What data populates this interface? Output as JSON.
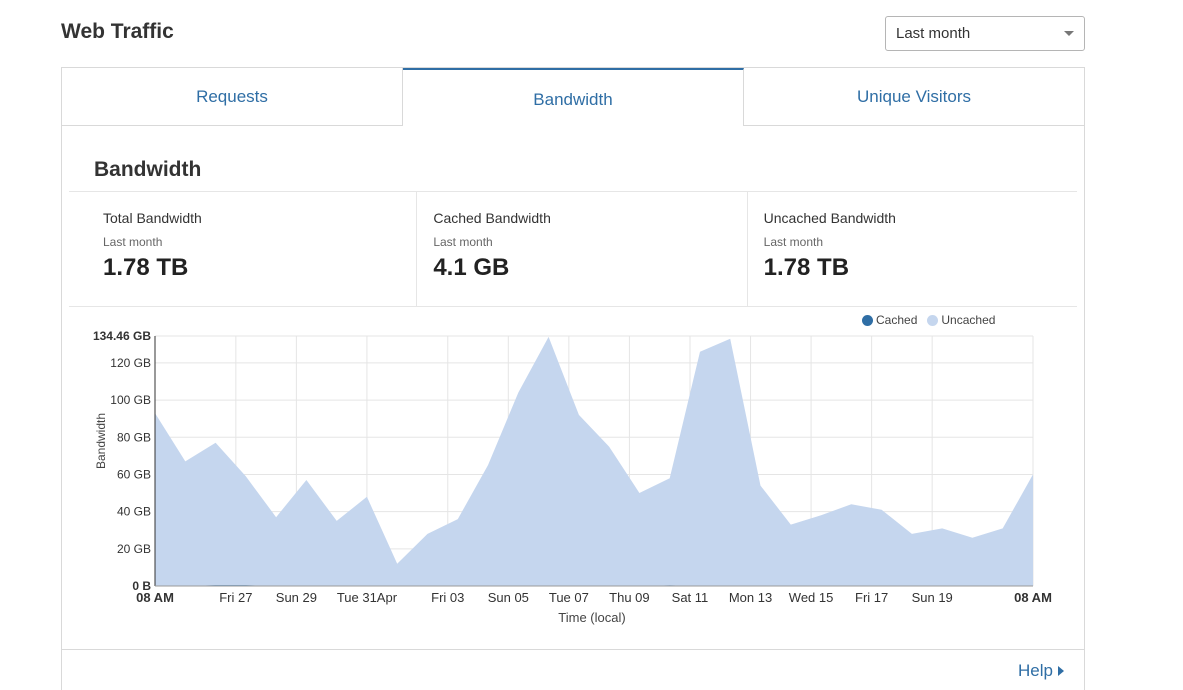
{
  "page": {
    "title": "Web Traffic"
  },
  "range_select": {
    "value": "Last month"
  },
  "tabs": [
    {
      "label": "Requests",
      "active": false
    },
    {
      "label": "Bandwidth",
      "active": true
    },
    {
      "label": "Unique Visitors",
      "active": false
    }
  ],
  "section": {
    "title": "Bandwidth"
  },
  "stats": [
    {
      "label": "Total Bandwidth",
      "period": "Last month",
      "value": "1.78 TB"
    },
    {
      "label": "Cached Bandwidth",
      "period": "Last month",
      "value": "4.1 GB"
    },
    {
      "label": "Uncached Bandwidth",
      "period": "Last month",
      "value": "1.78 TB"
    }
  ],
  "help": {
    "label": "Help"
  },
  "colors": {
    "accent": "#2f6ea5",
    "cached": "#2f6ea5",
    "uncached": "#c5d6ee",
    "grid": "#e5e5e5"
  },
  "chart_data": {
    "type": "area",
    "xlabel": "Time (local)",
    "ylabel": "Bandwidth",
    "y_unit": "GB",
    "ylim": [
      0,
      134.46
    ],
    "y_ticks": [
      {
        "value": 0,
        "label": "0 B",
        "bold": true
      },
      {
        "value": 20,
        "label": "20 GB"
      },
      {
        "value": 40,
        "label": "40 GB"
      },
      {
        "value": 60,
        "label": "60 GB"
      },
      {
        "value": 80,
        "label": "80 GB"
      },
      {
        "value": 100,
        "label": "100 GB"
      },
      {
        "value": 120,
        "label": "120 GB"
      },
      {
        "value": 134.46,
        "label": "134.46 GB",
        "bold": true
      }
    ],
    "x_ticks": [
      {
        "index": 0,
        "label": "08 AM",
        "bold": true
      },
      {
        "index": 2.67,
        "label": "Fri 27"
      },
      {
        "index": 4.67,
        "label": "Sun 29"
      },
      {
        "index": 7,
        "label": "Tue 31Apr"
      },
      {
        "index": 9.67,
        "label": "Fri 03"
      },
      {
        "index": 11.67,
        "label": "Sun 05"
      },
      {
        "index": 13.67,
        "label": "Tue 07"
      },
      {
        "index": 15.67,
        "label": "Thu 09"
      },
      {
        "index": 17.67,
        "label": "Sat 11"
      },
      {
        "index": 19.67,
        "label": "Mon 13"
      },
      {
        "index": 21.67,
        "label": "Wed 15"
      },
      {
        "index": 23.67,
        "label": "Fri 17"
      },
      {
        "index": 25.67,
        "label": "Sun 19"
      },
      {
        "index": 29,
        "label": "08 AM",
        "bold": true
      }
    ],
    "legend": [
      {
        "name": "Cached",
        "color": "#2f6ea5"
      },
      {
        "name": "Uncached",
        "color": "#c5d6ee"
      }
    ],
    "series": [
      {
        "name": "Uncached",
        "values": [
          93,
          67,
          77,
          59,
          37,
          57,
          35,
          48,
          12,
          28,
          36,
          65,
          104,
          134,
          92,
          75,
          50,
          58,
          126,
          133,
          54,
          33,
          38,
          44,
          41,
          28,
          31,
          26,
          31,
          60
        ]
      },
      {
        "name": "Cached",
        "values": [
          0,
          0,
          0.4,
          0.4,
          0,
          0,
          0,
          0,
          0,
          0,
          0,
          0,
          0,
          0,
          0,
          0,
          0,
          0.3,
          0,
          0,
          0,
          0,
          0,
          0,
          0,
          0,
          0,
          0,
          0,
          0
        ]
      }
    ]
  }
}
